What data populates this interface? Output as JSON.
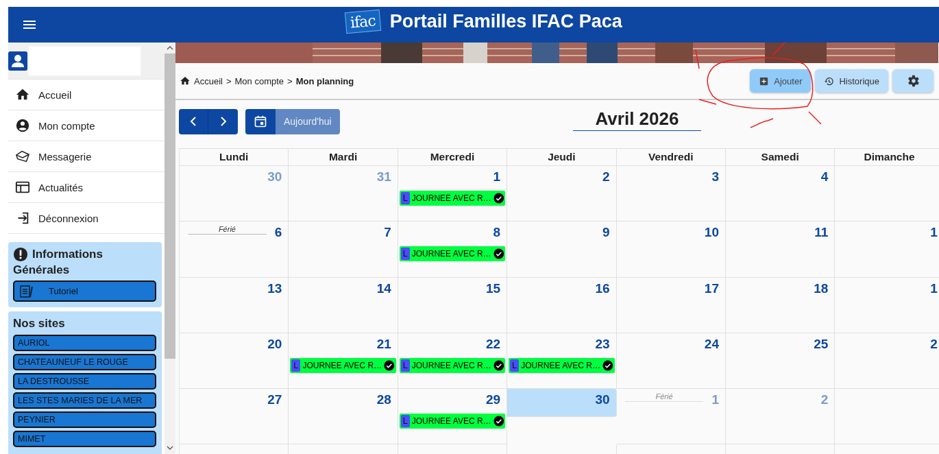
{
  "header": {
    "logo_text": "ifac",
    "title": "Portail Familles IFAC Paca"
  },
  "sidebar": {
    "nav": [
      {
        "label": "Accueil",
        "kind": "home"
      },
      {
        "label": "Mon compte",
        "kind": "account"
      },
      {
        "label": "Messagerie",
        "kind": "mail"
      },
      {
        "label": "Actualités",
        "kind": "news"
      },
      {
        "label": "Déconnexion",
        "kind": "logout"
      }
    ],
    "info": {
      "title_lines": [
        "Informations",
        "Générales"
      ],
      "buttons": [
        "Tutoriel"
      ]
    },
    "sites": {
      "title": "Nos sites",
      "items": [
        "AURIOL",
        "CHATEAUNEUF LE ROUGE",
        "LA DESTROUSSE",
        "LES STES MARIES DE LA MER",
        "PEYNIER",
        "MIMET"
      ]
    }
  },
  "breadcrumb": {
    "items": [
      "Accueil",
      "Mon compte",
      "Mon planning"
    ],
    "separators": [
      ">",
      ">"
    ]
  },
  "toolbar": [
    {
      "kind": "add",
      "label": "Ajouter",
      "highlighted": true
    },
    {
      "kind": "history",
      "label": "Historique",
      "highlighted": false
    },
    {
      "kind": "settings",
      "highlighted": false
    }
  ],
  "calendar": {
    "today_button": {
      "label": "Aujourd'hui",
      "disabled": true
    },
    "month": "Avril 2026",
    "weekdays": [
      "Lundi",
      "Mardi",
      "Mercredi",
      "Jeudi",
      "Vendredi",
      "Samedi",
      "Dimanche"
    ],
    "weeks": [
      [
        {
          "day": "30",
          "other_month": true,
          "today": false
        },
        {
          "day": "31",
          "other_month": true,
          "today": false
        },
        {
          "day": "1",
          "other_month": false,
          "today": false,
          "events": [
            {
              "badge": "L",
              "title": "JOURNEE AVEC R…",
              "confirmed": true
            }
          ]
        },
        {
          "day": "2",
          "other_month": false,
          "today": false
        },
        {
          "day": "3",
          "other_month": false,
          "today": false
        },
        {
          "day": "4",
          "other_month": false,
          "today": false
        }
      ],
      [
        {
          "day": "6",
          "other_month": false,
          "today": false,
          "holiday": "Férié"
        },
        {
          "day": "7",
          "other_month": false,
          "today": false
        },
        {
          "day": "8",
          "other_month": false,
          "today": false,
          "events": [
            {
              "badge": "L",
              "title": "JOURNEE AVEC R…",
              "confirmed": true
            }
          ]
        },
        {
          "day": "9",
          "other_month": false,
          "today": false
        },
        {
          "day": "10",
          "other_month": false,
          "today": false
        },
        {
          "day": "11",
          "other_month": false,
          "today": false
        },
        {
          "day": "1",
          "other_month": false,
          "today": false
        }
      ],
      [
        {
          "day": "13",
          "other_month": false,
          "today": false
        },
        {
          "day": "14",
          "other_month": false,
          "today": false
        },
        {
          "day": "15",
          "other_month": false,
          "today": false
        },
        {
          "day": "16",
          "other_month": false,
          "today": false
        },
        {
          "day": "17",
          "other_month": false,
          "today": false
        },
        {
          "day": "18",
          "other_month": false,
          "today": false
        },
        {
          "day": "1",
          "other_month": false,
          "today": false
        }
      ],
      [
        {
          "day": "20",
          "other_month": false,
          "today": false
        },
        {
          "day": "21",
          "other_month": false,
          "today": false,
          "events": [
            {
              "badge": "L",
              "title": "JOURNEE AVEC R…",
              "confirmed": true
            }
          ]
        },
        {
          "day": "22",
          "other_month": false,
          "today": false,
          "events": [
            {
              "badge": "L",
              "title": "JOURNEE AVEC R…",
              "confirmed": true
            }
          ]
        },
        {
          "day": "23",
          "other_month": false,
          "today": false,
          "events": [
            {
              "badge": "L",
              "title": "JOURNEE AVEC R…",
              "confirmed": true
            }
          ]
        },
        {
          "day": "24",
          "other_month": false,
          "today": false
        },
        {
          "day": "25",
          "other_month": false,
          "today": false
        },
        {
          "day": "2",
          "other_month": false,
          "today": false
        }
      ],
      [
        {
          "day": "27",
          "other_month": false,
          "today": false
        },
        {
          "day": "28",
          "other_month": false,
          "today": false
        },
        {
          "day": "29",
          "other_month": false,
          "today": false,
          "events": [
            {
              "badge": "L",
              "title": "JOURNEE AVEC R…",
              "confirmed": true
            }
          ]
        },
        {
          "day": "30",
          "other_month": false,
          "today": true
        },
        {
          "day": "1",
          "other_month": true,
          "today": false,
          "holiday": "Férié"
        },
        {
          "day": "2",
          "other_month": true,
          "today": false
        }
      ]
    ]
  }
}
